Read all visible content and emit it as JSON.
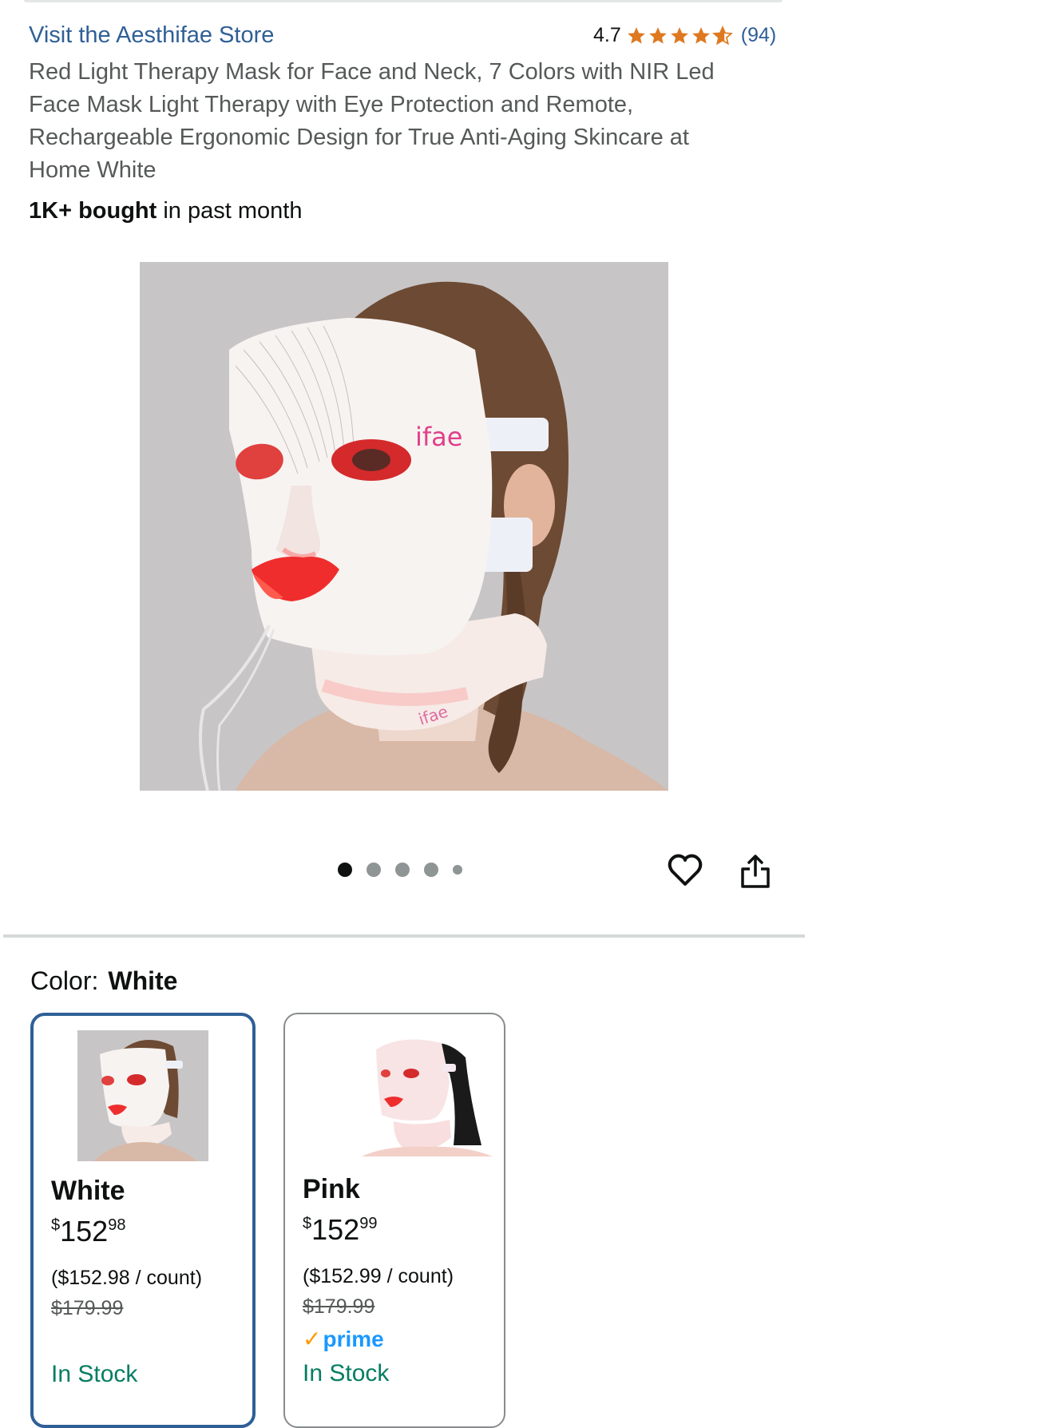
{
  "store": {
    "link_text": "Visit the Aesthifae Store"
  },
  "rating": {
    "value": "4.7",
    "stars": 4.7,
    "count_text": "(94)"
  },
  "product": {
    "title": "Red Light Therapy Mask for Face and Neck, 7 Colors with NIR Led Face Mask Light Therapy with Eye Protection and Remote, Rechargeable Ergonomic Design for True Anti-Aging Skincare at Home White",
    "bought_bold": "1K+ bought",
    "bought_rest": " in past month",
    "image_brand_text": "ifae"
  },
  "gallery": {
    "image_count": 5,
    "active_index": 0
  },
  "actions": {
    "heart_icon": "heart-icon",
    "share_icon": "share-icon"
  },
  "color": {
    "label": "Color:",
    "selected": "White",
    "options": [
      {
        "name": "White",
        "price_symbol": "$",
        "price_whole": "152",
        "price_fraction": "98",
        "unit_price": "($152.98 / count)",
        "list_price": "$179.99",
        "prime": "",
        "stock": "In Stock"
      },
      {
        "name": "Pink",
        "price_symbol": "$",
        "price_whole": "152",
        "price_fraction": "99",
        "unit_price": "($152.99 / count)",
        "list_price": "$179.99",
        "prime": "prime",
        "stock": "In Stock"
      }
    ]
  },
  "colors": {
    "link": "#2f5f96",
    "star": "#de7921",
    "stock": "#067d62",
    "selected_border": "#2f5f96",
    "prime": "#1a98ff"
  }
}
